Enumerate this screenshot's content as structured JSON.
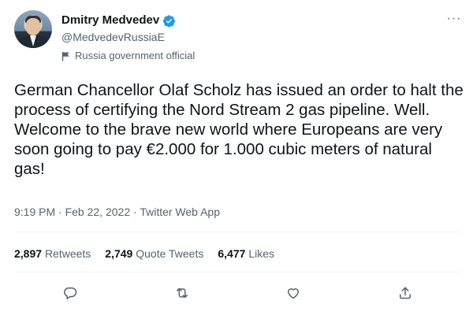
{
  "author": {
    "name": "Dmitry Medvedev",
    "handle": "@MedvedevRussiaE",
    "label": "Russia government official",
    "verified": true
  },
  "tweet": {
    "text": "German Chancellor Olaf Scholz has issued an order to halt the process of certifying the Nord Stream 2 gas pipeline. Well. Welcome to the brave new world where Europeans are very soon going to pay €2.000 for 1.000 cubic meters of natural gas!",
    "time": "9:19 PM",
    "date": "Feb 22, 2022",
    "source": "Twitter Web App",
    "separator": "·"
  },
  "stats": {
    "retweets_count": "2,897",
    "retweets_label": "Retweets",
    "quotes_count": "2,749",
    "quotes_label": "Quote Tweets",
    "likes_count": "6,477",
    "likes_label": "Likes"
  },
  "more_label": "···",
  "icons": {
    "verified": "verified-badge-icon",
    "label": "flag-icon",
    "more": "more-options-icon",
    "reply": "reply-icon",
    "retweet": "retweet-icon",
    "like": "heart-icon",
    "share": "share-icon"
  },
  "colors": {
    "text": "#0f1419",
    "secondary": "#536471",
    "verified": "#1d9bf0",
    "divider": "#eff3f4"
  }
}
